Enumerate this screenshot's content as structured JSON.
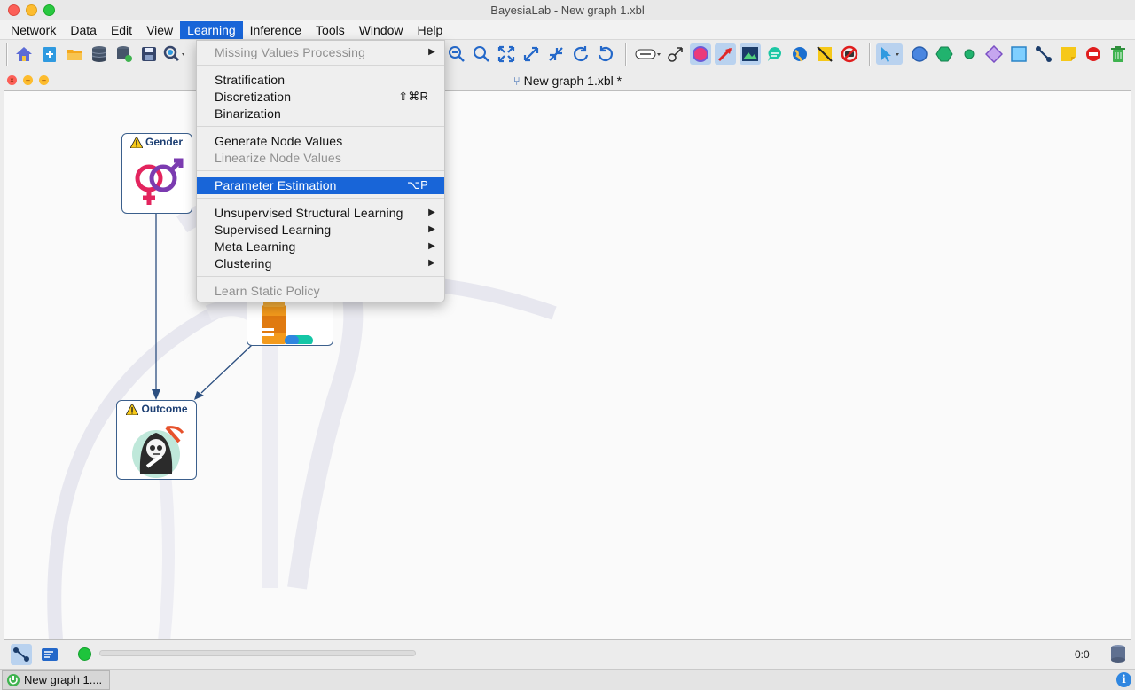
{
  "window": {
    "title": "BayesiaLab - New graph 1.xbl"
  },
  "menubar": {
    "items": [
      {
        "label": "Network"
      },
      {
        "label": "Data"
      },
      {
        "label": "Edit"
      },
      {
        "label": "View"
      },
      {
        "label": "Learning"
      },
      {
        "label": "Inference"
      },
      {
        "label": "Tools"
      },
      {
        "label": "Window"
      },
      {
        "label": "Help"
      }
    ],
    "active": "Learning"
  },
  "graph_frame": {
    "title": "New graph 1.xbl *"
  },
  "nodes": {
    "gender": {
      "label": "Gender"
    },
    "outcome": {
      "label": "Outcome"
    }
  },
  "learning_menu": {
    "missing_values": "Missing Values Processing",
    "stratification": "Stratification",
    "discretization": "Discretization",
    "discretization_shortcut": "⇧⌘R",
    "binarization": "Binarization",
    "generate_node_values": "Generate Node Values",
    "linearize_node_values": "Linearize Node Values",
    "parameter_estimation": "Parameter Estimation",
    "parameter_estimation_shortcut": "⌥P",
    "unsupervised": "Unsupervised Structural Learning",
    "supervised": "Supervised Learning",
    "meta": "Meta Learning",
    "clustering": "Clustering",
    "learn_static_policy": "Learn Static Policy"
  },
  "status": {
    "coords": "0:0"
  },
  "taskbar": {
    "tab_label": "New graph 1...."
  },
  "colors": {
    "accent": "#1865d8",
    "node_border": "#3b5f8c",
    "node_title": "#1d3f73"
  }
}
